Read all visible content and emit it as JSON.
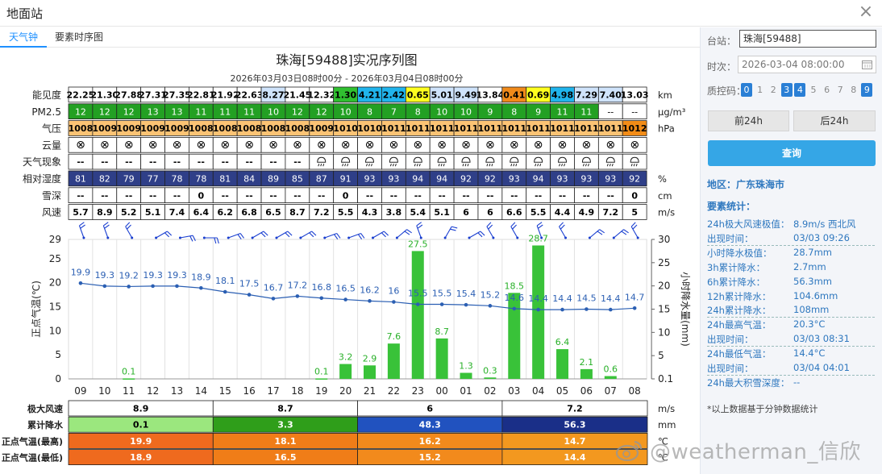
{
  "window": {
    "title": "地面站",
    "close_glyph": "×"
  },
  "tabs": [
    "天气钟",
    "要素时序图"
  ],
  "chart_data": {
    "type": "table",
    "title": "珠海[59488]实况序列图",
    "subtitle": "2026年03月03日08时00分 - 2026年03月04日08时00分",
    "hours": [
      "09",
      "10",
      "11",
      "12",
      "13",
      "14",
      "15",
      "16",
      "17",
      "18",
      "19",
      "20",
      "21",
      "22",
      "23",
      "00",
      "01",
      "02",
      "03",
      "04",
      "05",
      "06",
      "07",
      "08"
    ],
    "rows": [
      {
        "label": "能见度",
        "unit": "km",
        "type": "vis",
        "values": [
          "22.25",
          "21.30",
          "27.88",
          "27.31",
          "27.35",
          "22.81",
          "21.92",
          "22.63",
          "8.27",
          "21.45",
          "12.32",
          "1.30",
          "4.21",
          "2.42",
          "0.65",
          "5.01",
          "9.49",
          "13.84",
          "0.41",
          "0.69",
          "4.98",
          "7.29",
          "7.40",
          "13.03"
        ]
      },
      {
        "label": "PM2.5",
        "unit": "μg/m³",
        "type": "pm",
        "values": [
          "12",
          "12",
          "12",
          "13",
          "13",
          "11",
          "11",
          "11",
          "10",
          "12",
          "12",
          "10",
          "8",
          "7",
          "8",
          "10",
          "10",
          "9",
          "8",
          "9",
          "11",
          "11",
          "--",
          "--"
        ]
      },
      {
        "label": "气压",
        "unit": "hPa",
        "type": "pres",
        "values": [
          "1008",
          "1009",
          "1009",
          "1009",
          "1009",
          "1008",
          "1008",
          "1008",
          "1008",
          "1008",
          "1009",
          "1010",
          "1010",
          "1011",
          "1011",
          "1011",
          "1011",
          "1011",
          "1011",
          "1011",
          "1011",
          "1011",
          "1011",
          "1012"
        ]
      },
      {
        "label": "云量",
        "unit": "",
        "type": "cloud",
        "values": [
          "⊗",
          "⊗",
          "⊗",
          "⊗",
          "⊗",
          "⊗",
          "⊗",
          "⊗",
          "⊗",
          "⊗",
          "⊗",
          "⊗",
          "⊗",
          "⊗",
          "⊗",
          "⊗",
          "⊗",
          "⊗",
          "⊗",
          "⊗",
          "⊗",
          "⊗",
          "⊗",
          "⊗"
        ]
      },
      {
        "label": "天气现象",
        "unit": "",
        "type": "wx",
        "values": [
          "--",
          "--",
          "--",
          "--",
          "--",
          "--",
          "--",
          "--",
          "--",
          "--",
          "rain",
          "rain",
          "rain",
          "rain",
          "rain",
          "rain",
          "rain",
          "rain",
          "rain",
          "rain",
          "rain",
          "rain",
          "rain",
          "rain"
        ]
      },
      {
        "label": "相对湿度",
        "unit": "%",
        "type": "rh",
        "values": [
          "81",
          "82",
          "79",
          "77",
          "78",
          "78",
          "81",
          "84",
          "89",
          "85",
          "87",
          "91",
          "93",
          "93",
          "94",
          "94",
          "92",
          "92",
          "93",
          "94",
          "93",
          "93",
          "93",
          "92"
        ]
      },
      {
        "label": "雪深",
        "unit": "cm",
        "type": "plain",
        "values": [
          "--",
          "--",
          "--",
          "--",
          "--",
          "0",
          "--",
          "--",
          "--",
          "--",
          "--",
          "0",
          "--",
          "--",
          "--",
          "--",
          "--",
          "--",
          "--",
          "--",
          "--",
          "--",
          "--",
          "0"
        ]
      },
      {
        "label": "风速",
        "unit": "m/s",
        "type": "plain",
        "values": [
          "5.7",
          "8.9",
          "5.2",
          "5.1",
          "7.4",
          "6.4",
          "6.2",
          "6.8",
          "6.5",
          "8.7",
          "7.2",
          "5.5",
          "4.3",
          "3.8",
          "5.4",
          "5.1",
          "6",
          "6",
          "6.6",
          "5.5",
          "4.4",
          "4.9",
          "7.2",
          "5"
        ]
      }
    ],
    "wind_dir_deg": [
      340,
      340,
      330,
      60,
      80,
      90,
      70,
      60,
      60,
      60,
      70,
      70,
      60,
      50,
      340,
      30,
      60,
      330,
      330,
      340,
      330,
      50,
      50,
      330
    ],
    "temperature": [
      19.9,
      19.3,
      19.2,
      19.3,
      19.3,
      18.9,
      18.1,
      17.5,
      16.7,
      17.2,
      16.8,
      16.5,
      16.2,
      16,
      15.5,
      15.5,
      15.4,
      15.2,
      14.6,
      14.4,
      14.4,
      14.5,
      14.4,
      14.7
    ],
    "temperature_labels": [
      "19.9",
      "19.3",
      "19.2",
      "19.3",
      "19.3",
      "18.9",
      "18.1",
      "17.5",
      "16.7",
      "17.2",
      "16.8",
      "16.5",
      "16.2",
      "16",
      "15.5",
      "15.5",
      "15.4",
      "15.2",
      "14.6",
      "14.4",
      "14.4",
      "14.5",
      "14.4",
      "14.7"
    ],
    "precip": [
      0,
      0,
      0.1,
      0,
      0,
      0,
      0,
      0,
      0,
      0,
      0.1,
      3.2,
      2.9,
      7.6,
      27.5,
      8.7,
      1.3,
      0.3,
      18.5,
      28.7,
      6.4,
      2.1,
      0.6,
      0
    ],
    "precip_labels": [
      "",
      "",
      "0.1",
      "",
      "",
      "",
      "",
      "",
      "",
      "",
      "0.1",
      "3.2",
      "2.9",
      "7.6",
      "27.5",
      "8.7",
      "1.3",
      "0.3",
      "18.5",
      "28.7",
      "6.4",
      "2.1",
      "0.6",
      ""
    ],
    "y_left": {
      "label": "正点气温(℃)",
      "ticks": [
        "0",
        "5",
        "10",
        "15",
        "20",
        "25",
        "29"
      ],
      "range": [
        0,
        29
      ]
    },
    "y_right": {
      "label": "小时降水量(mm)",
      "ticks": [
        "0.1",
        "5",
        "10",
        "15",
        "20",
        "25",
        "30"
      ],
      "range": [
        0,
        30
      ]
    },
    "summary": [
      {
        "label": "极大风速",
        "unit": "m/s",
        "values": [
          "8.9",
          "8.7",
          "6",
          "7.2"
        ]
      },
      {
        "label": "累计降水",
        "unit": "mm",
        "values": [
          "0.1",
          "3.3",
          "48.3",
          "56.3"
        ]
      },
      {
        "label": "正点气温(最高)",
        "unit": "℃",
        "values": [
          "19.9",
          "18.1",
          "16.2",
          "14.7"
        ]
      },
      {
        "label": "正点气温(最低)",
        "unit": "℃",
        "values": [
          "18.9",
          "16.5",
          "15.2",
          "14.4"
        ]
      }
    ],
    "colors": {
      "line": "#2b5fb3",
      "bar": "#39c239",
      "bar_label": "#28b028",
      "rh": "#2f3f88",
      "pm": "#23a023",
      "pres": "#f0941e"
    }
  },
  "panel": {
    "station_label": "台站：",
    "station_value": "珠海[59488]",
    "time_label": "时次：",
    "time_value": "2026-03-04 08:00:00",
    "qc_label": "质控码：",
    "qc_codes": [
      {
        "n": "0",
        "on": true
      },
      {
        "n": "1",
        "on": false
      },
      {
        "n": "2",
        "on": false
      },
      {
        "n": "3",
        "on": true
      },
      {
        "n": "4",
        "on": true
      },
      {
        "n": "5",
        "on": false
      },
      {
        "n": "6",
        "on": false
      },
      {
        "n": "7",
        "on": false
      },
      {
        "n": "8",
        "on": false
      },
      {
        "n": "9",
        "on": true
      }
    ],
    "prev_btn": "前24h",
    "next_btn": "后24h",
    "query_btn": "查询",
    "region": "地区：广东珠海市",
    "stats_title": "要素统计：",
    "stats": [
      {
        "k": "24h极大风速极值：",
        "v": "8.9m/s 西北风",
        "dash": false
      },
      {
        "k": "出现时间：",
        "v": "03/03 09:26",
        "dash": true
      },
      {
        "k": "小时降水极值：",
        "v": "28.7mm",
        "dash": false
      },
      {
        "k": "3h累计降水：",
        "v": "2.7mm",
        "dash": false
      },
      {
        "k": "6h累计降水：",
        "v": "56.3mm",
        "dash": false
      },
      {
        "k": "12h累计降水：",
        "v": "104.6mm",
        "dash": false
      },
      {
        "k": "24h累计降水：",
        "v": "108mm",
        "dash": true
      },
      {
        "k": "24h最高气温：",
        "v": "20.3°C",
        "dash": false
      },
      {
        "k": "出现时间：",
        "v": "03/03 08:31",
        "dash": true
      },
      {
        "k": "24h最低气温：",
        "v": "14.4°C",
        "dash": false
      },
      {
        "k": "出现时间：",
        "v": "03/04 04:01",
        "dash": true
      },
      {
        "k": "24h最大积雪深度：",
        "v": "--",
        "dash": false
      }
    ],
    "note": "*以上数据基于分钟数据统计"
  },
  "watermark": "@weatherman_信欣"
}
